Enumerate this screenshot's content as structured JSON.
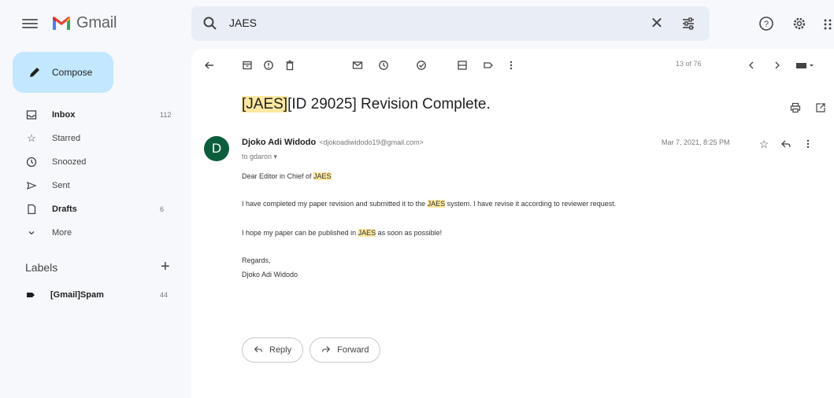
{
  "header": {
    "app_name": "Gmail",
    "search_value": "JAES",
    "search_clear": "✕"
  },
  "sidebar": {
    "compose_label": "Compose",
    "items": [
      {
        "label": "Inbox",
        "count": "112",
        "icon": "inbox-icon",
        "bold": true
      },
      {
        "label": "Starred",
        "count": "",
        "icon": "star-icon",
        "bold": false
      },
      {
        "label": "Snoozed",
        "count": "",
        "icon": "clock-icon",
        "bold": false
      },
      {
        "label": "Sent",
        "count": "",
        "icon": "send-icon",
        "bold": false
      },
      {
        "label": "Drafts",
        "count": "6",
        "icon": "draft-icon",
        "bold": true
      },
      {
        "label": "More",
        "count": "",
        "icon": "chevron-down-icon",
        "bold": false
      }
    ],
    "labels_heading": "Labels",
    "labels_add": "+",
    "labels": [
      {
        "label": "[Gmail]Spam",
        "count": "44"
      }
    ]
  },
  "toolbar": {
    "page_count": "13 of 76"
  },
  "message": {
    "subject_highlight": "[JAES]",
    "subject_rest": "[ID 29025] Revision Complete.",
    "avatar_letter": "D",
    "sender_name": "Djoko Adi Widodo",
    "sender_email": "<djokoadiwidodo19@gmail.com>",
    "to_line": "to gdaron ▾",
    "date": "Mar 7, 2021, 8:25 PM",
    "body": {
      "greeting_pre": "Dear Editor in Chief of ",
      "greeting_hl": "JAES",
      "p1_pre": "I have completed my paper revision and submitted it to the ",
      "p1_hl": "JAES",
      "p1_post": " system. I have revise it according to reviewer request.",
      "p2_pre": "I hope my paper can be published in ",
      "p2_hl": "JAES",
      "p2_post": " as soon as possible!",
      "signoff": "Regards,",
      "signature": "Djoko Adi Widodo"
    },
    "reply_label": "Reply",
    "forward_label": "Forward"
  }
}
